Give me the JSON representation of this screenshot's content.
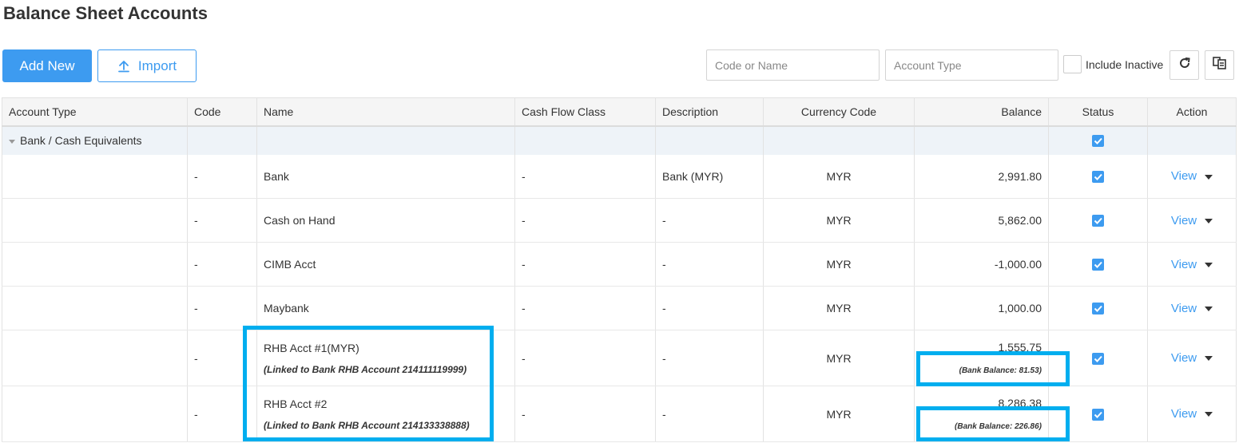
{
  "page": {
    "title": "Balance Sheet Accounts"
  },
  "toolbar": {
    "add_new_label": "Add New",
    "import_label": "Import",
    "code_name_placeholder": "Code or Name",
    "account_type_placeholder": "Account Type",
    "include_inactive_label": "Include Inactive"
  },
  "table": {
    "columns": [
      "Account Type",
      "Code",
      "Name",
      "Cash Flow Class",
      "Description",
      "Currency Code",
      "Balance",
      "Status",
      "Action"
    ],
    "group": {
      "label": "Bank / Cash Equivalents"
    },
    "rows": [
      {
        "code": "-",
        "name": "Bank",
        "cash_flow_class": "-",
        "description": "Bank (MYR)",
        "currency": "MYR",
        "balance": "2,991.80",
        "action": "View"
      },
      {
        "code": "-",
        "name": "Cash on Hand",
        "cash_flow_class": "-",
        "description": "-",
        "currency": "MYR",
        "balance": "5,862.00",
        "action": "View"
      },
      {
        "code": "-",
        "name": "CIMB Acct",
        "cash_flow_class": "-",
        "description": "-",
        "currency": "MYR",
        "balance": "-1,000.00",
        "action": "View"
      },
      {
        "code": "-",
        "name": "Maybank",
        "cash_flow_class": "-",
        "description": "-",
        "currency": "MYR",
        "balance": "1,000.00",
        "action": "View"
      },
      {
        "code": "-",
        "name": "RHB Acct #1(MYR)",
        "linked_note": "(Linked to Bank RHB Account 214111119999)",
        "cash_flow_class": "-",
        "description": "-",
        "currency": "MYR",
        "balance": "1,555.75",
        "bank_balance": "(Bank Balance: 81.53)",
        "action": "View"
      },
      {
        "code": "-",
        "name": "RHB Acct #2",
        "linked_note": "(Linked to Bank RHB Account 214133338888)",
        "cash_flow_class": "-",
        "description": "-",
        "currency": "MYR",
        "balance": "8,286.38",
        "bank_balance": "(Bank Balance: 226.86)",
        "action": "View"
      }
    ]
  },
  "colors": {
    "accent": "#3d9bf0",
    "highlight": "#00aeef",
    "group_bg": "#eef3f8"
  }
}
